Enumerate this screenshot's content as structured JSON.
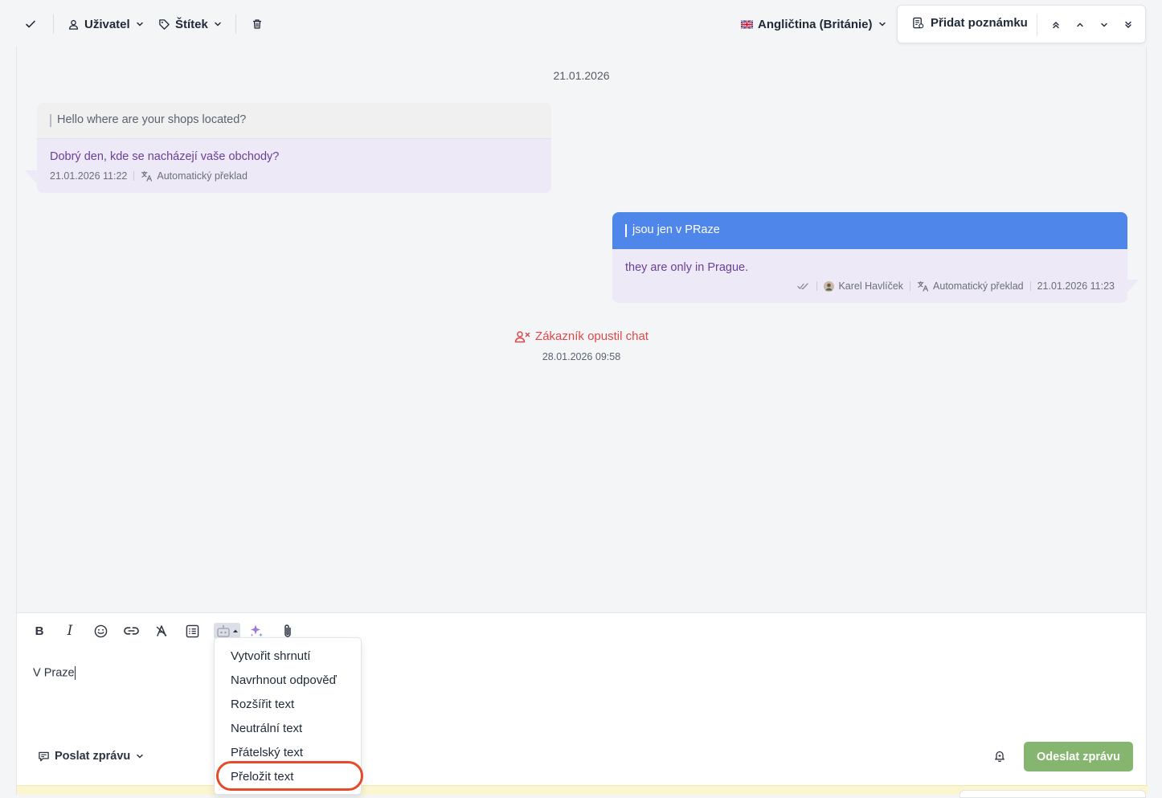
{
  "toolbar": {
    "user_label": "Uživatel",
    "tag_label": "Štítek",
    "language_label": "Angličtina (Británie)",
    "add_note_label": "Přidat poznámku"
  },
  "conversation": {
    "date_header": "21.01.2026",
    "incoming": {
      "original": "Hello where are your shops located?",
      "translated": "Dobrý den, kde se nacházejí vaše obchody?",
      "time": "21.01.2026 11:22",
      "translation_label": "Automatický překlad"
    },
    "outgoing": {
      "original": "jsou jen v PRaze",
      "translated": "they are only in Prague.",
      "agent": "Karel Havlíček",
      "translation_label": "Automatický překlad",
      "time": "21.01.2026 11:23"
    },
    "event": {
      "label": "Zákazník opustil chat",
      "time": "28.01.2026 09:58"
    }
  },
  "composer": {
    "text": "V Praze",
    "send_mode_label": "Poslat zprávu",
    "send_button_label": "Odeslat zprávu"
  },
  "ai_menu": {
    "items": [
      "Vytvořit shrnutí",
      "Navrhnout odpověď",
      "Rozšířit text",
      "Neutrální text",
      "Přátelský text",
      "Přeložit text"
    ],
    "highlighted": "Přeložit text"
  },
  "colors": {
    "accent_blue": "#4f86ea",
    "translated_text": "#6b3f9a",
    "send_button": "#86b56f",
    "event_red": "#e04848",
    "highlight_ring": "#e34b2a"
  }
}
